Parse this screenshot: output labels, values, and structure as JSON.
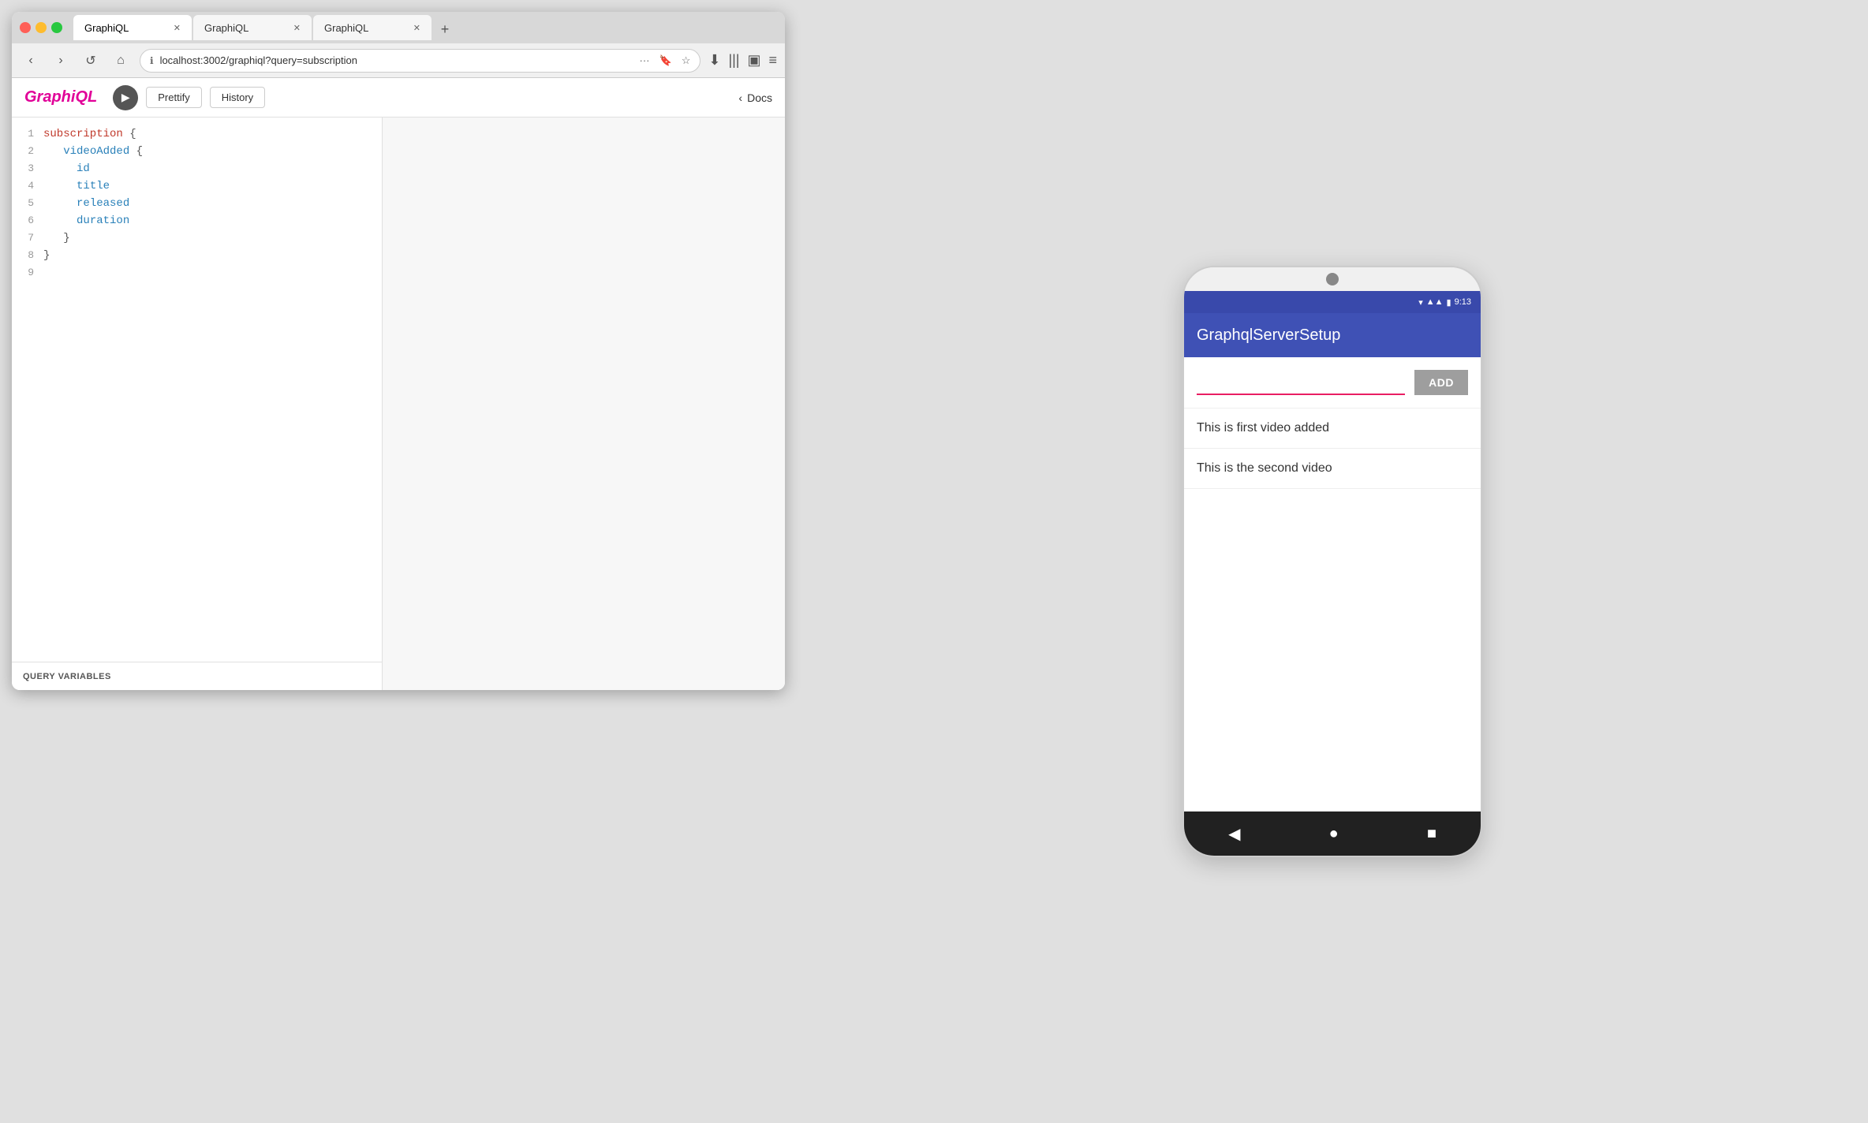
{
  "browser": {
    "tabs": [
      {
        "label": "GraphiQL",
        "active": true
      },
      {
        "label": "GraphiQL",
        "active": false
      },
      {
        "label": "GraphiQL",
        "active": false
      }
    ],
    "url": "localhost:3002/graphiql?query=subscription",
    "address_icon": "ℹ"
  },
  "nav": {
    "back": "‹",
    "forward": "›",
    "reload": "↺",
    "home": "⌂",
    "options": "···",
    "download": "⬇",
    "bookmarks": "|||",
    "reader": "□",
    "menu": "≡"
  },
  "graphiql": {
    "logo_text": "Graph",
    "logo_italic": "i",
    "logo_rest": "QL",
    "run_button": "▶",
    "prettify_label": "Prettify",
    "history_label": "History",
    "docs_label": "Docs",
    "code_lines": [
      {
        "num": "1",
        "content": "subscription {",
        "indent": 0
      },
      {
        "num": "2",
        "content": "  videoAdded {",
        "indent": 1
      },
      {
        "num": "3",
        "content": "    id",
        "indent": 2
      },
      {
        "num": "4",
        "content": "    title",
        "indent": 2
      },
      {
        "num": "5",
        "content": "    released",
        "indent": 2
      },
      {
        "num": "6",
        "content": "    duration",
        "indent": 2
      },
      {
        "num": "7",
        "content": "  }",
        "indent": 1
      },
      {
        "num": "8",
        "content": "}",
        "indent": 0
      },
      {
        "num": "9",
        "content": "",
        "indent": 0
      }
    ],
    "query_vars_label": "QUERY VARIABLES"
  },
  "phone": {
    "time": "9:13",
    "app_title": "GraphqlServerSetup",
    "add_button": "ADD",
    "list_items": [
      "This is first video added",
      "This is the second video"
    ],
    "nav_icons": [
      "◀",
      "●",
      "■"
    ]
  }
}
